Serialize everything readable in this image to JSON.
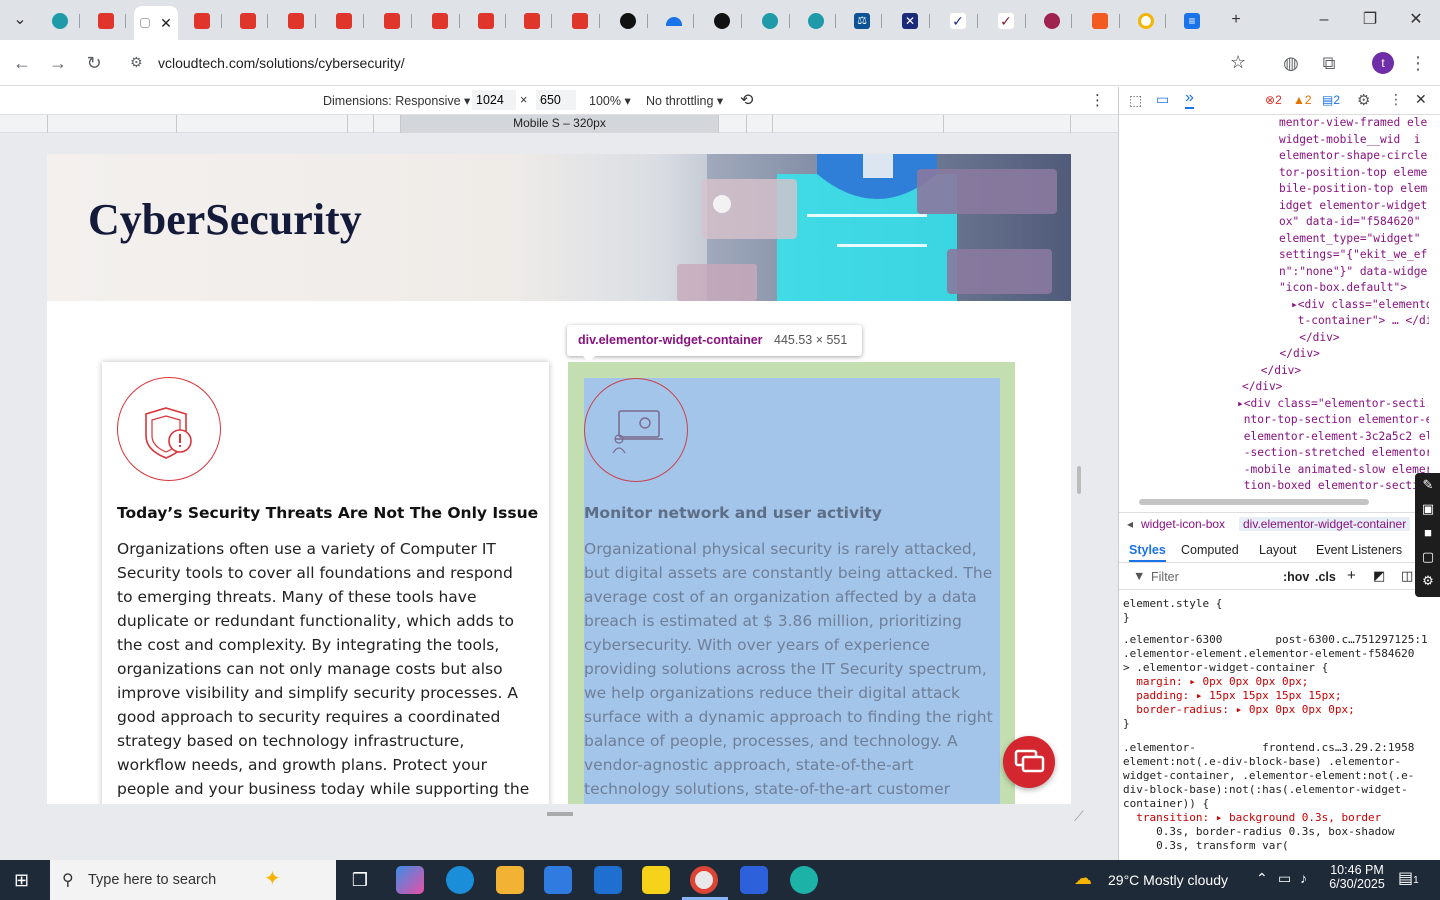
{
  "browser": {
    "tabs": [
      {
        "icon": "tab-favicon-teal"
      },
      {
        "icon": "tab-favicon-red"
      },
      {
        "icon": "tab-active"
      },
      {
        "icon": "tab-favicon-red"
      },
      {
        "icon": "tab-favicon-red"
      },
      {
        "icon": "tab-favicon-red"
      },
      {
        "icon": "tab-favicon-red"
      },
      {
        "icon": "tab-favicon-red"
      },
      {
        "icon": "tab-favicon-red"
      },
      {
        "icon": "tab-favicon-red"
      },
      {
        "icon": "tab-favicon-red"
      },
      {
        "icon": "tab-favicon-red"
      }
    ],
    "url": "vcloudtech.com/solutions/cybersecurity/"
  },
  "device_toolbar": {
    "dimensions_label": "Dimensions: Responsive",
    "width": "1024",
    "times": "×",
    "height": "650",
    "zoom": "100%",
    "throttling": "No throttling",
    "ruler_label": "Mobile S – 320px"
  },
  "page": {
    "hero_title": "CyberSecurity",
    "card1": {
      "heading": "Today’s Security Threats Are Not The Only Issue",
      "lines": [
        "Organizations often use a variety of Computer IT",
        "Security tools to cover all foundations and respond",
        "to emerging threats. Many of these tools have",
        "duplicate or redundant functionality, which adds to",
        "the cost and complexity. By integrating the tools,",
        "organizations can not only manage costs but also",
        "improve visibility and simplify security processes. A",
        "good approach to security requires a coordinated",
        "strategy based on technology infrastructure,",
        "workflow needs, and growth plans. Protect your",
        "people and your business today while supporting the"
      ]
    },
    "card2": {
      "heading": "Monitor network and user activity",
      "lines": [
        "Organizational physical security is rarely attacked,",
        "but digital assets are constantly being attacked. The",
        "average cost of an organization affected by a data",
        "breach is estimated at $ 3.86 million, prioritizing",
        "cybersecurity. With over years of experience",
        "providing solutions across the IT Security spectrum,",
        "we help organizations reduce their digital attack",
        "surface with a dynamic approach to finding the right",
        "balance of people, processes, and technology. A",
        "vendor-agnostic approach, state-of-the-art",
        "technology solutions, state-of-the-art customer"
      ]
    },
    "tooltip": {
      "selector": "div.elementor-widget-container",
      "size": "445.53 × 551"
    }
  },
  "devtools": {
    "errors": "2",
    "warnings": "2",
    "messages": "2",
    "dom_lines": [
      "mentor-view-framed ele",
      "widget-mobile__wid  i",
      "elementor-shape-circle",
      "tor-position-top eleme",
      "bile-position-top elem",
      "idget elementor-widget",
      "ox\" data-id=\"f584620\"",
      "element_type=\"widget\"",
      "settings=\"{\"ekit_we_ef",
      "n\":\"none\"}\" data-widge",
      "\"icon-box.default\">",
      "▸<div class=\"elementor",
      " t-container\"> … </di",
      "   </div>",
      "  </div>",
      " </div>",
      "</div>",
      "▸<div class=\"elementor-secti",
      " ntor-top-section elementor-e",
      " elementor-element-3c2a5c2 el",
      " -section-stretched elementor",
      " -mobile animated-slow elemer",
      " tion-boxed elementor-secti"
    ],
    "breadcrumbs": [
      "widget-icon-box",
      "div.elementor-widget-container"
    ],
    "panel_tabs": [
      "Styles",
      "Computed",
      "Layout",
      "Event Listeners"
    ],
    "filter_placeholder": "Filter",
    "hov": ":hov",
    "cls": ".cls",
    "styles_lines": [
      "element.style {",
      "}",
      ".elementor-6300        post-6300.c…751297125:1",
      ".elementor-element.elementor-element-f584620",
      "> .elementor-widget-container {",
      "  margin: ▸ 0px 0px 0px 0px;",
      "  padding: ▸ 15px 15px 15px 15px;",
      "  border-radius: ▸ 0px 0px 0px 0px;",
      "}",
      ".elementor-          frontend.cs…3.29.2:1958",
      "element:not(.e-div-block-base) .elementor-",
      "widget-container, .elementor-element:not(.e-",
      "div-block-base):not(:has(.elementor-widget-",
      "container)) {",
      "  transition: ▸ background 0.3s, border",
      "     0.3s, border-radius 0.3s, box-shadow",
      "     0.3s, transform var("
    ]
  },
  "taskbar": {
    "search_placeholder": "Type here to search",
    "weather": "29°C  Mostly cloudy",
    "time": "10:46 PM",
    "date": "6/30/2025",
    "notif_count": "1"
  }
}
